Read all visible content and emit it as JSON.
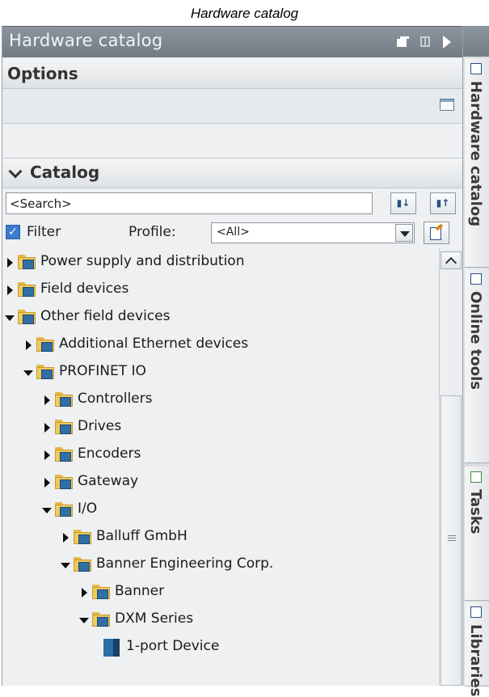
{
  "caption": "Hardware catalog",
  "panel": {
    "title": "Hardware catalog",
    "options_label": "Options",
    "catalog_label": "Catalog"
  },
  "search": {
    "value": "<Search>"
  },
  "filter": {
    "label": "Filter",
    "checked": true,
    "profile_label": "Profile:",
    "profile_value": "<All>"
  },
  "tree": [
    {
      "label": "Power supply and distribution",
      "icon": "folder-icon",
      "state": "collapsed",
      "level": 0
    },
    {
      "label": "Field devices",
      "icon": "folder-icon",
      "state": "collapsed",
      "level": 0
    },
    {
      "label": "Other field devices",
      "icon": "folder-icon",
      "state": "expanded",
      "level": 0
    },
    {
      "label": "Additional Ethernet devices",
      "icon": "folder-icon",
      "state": "collapsed",
      "level": 1
    },
    {
      "label": "PROFINET IO",
      "icon": "folder-icon",
      "state": "expanded",
      "level": 1
    },
    {
      "label": "Controllers",
      "icon": "folder-icon",
      "state": "collapsed",
      "level": 2
    },
    {
      "label": "Drives",
      "icon": "folder-icon",
      "state": "collapsed",
      "level": 2
    },
    {
      "label": "Encoders",
      "icon": "folder-icon",
      "state": "collapsed",
      "level": 2
    },
    {
      "label": "Gateway",
      "icon": "folder-icon",
      "state": "collapsed",
      "level": 2
    },
    {
      "label": "I/O",
      "icon": "folder-icon",
      "state": "expanded",
      "level": 2
    },
    {
      "label": "Balluff GmbH",
      "icon": "folder-icon",
      "state": "collapsed",
      "level": 3
    },
    {
      "label": "Banner Engineering Corp.",
      "icon": "folder-icon",
      "state": "expanded",
      "level": 3
    },
    {
      "label": "Banner",
      "icon": "folder-icon",
      "state": "collapsed",
      "level": 4
    },
    {
      "label": "DXM Series",
      "icon": "folder-icon",
      "state": "expanded",
      "level": 4
    },
    {
      "label": "1-port Device",
      "icon": "device-icon",
      "state": "leaf",
      "level": 5
    }
  ],
  "side_tabs": [
    {
      "label": "Hardware catalog",
      "icon": "catalog-icon"
    },
    {
      "label": "Online tools",
      "icon": "online-tools-icon"
    },
    {
      "label": "Tasks",
      "icon": "tasks-icon"
    },
    {
      "label": "Libraries",
      "icon": "libraries-icon"
    }
  ],
  "colors": {
    "title_bar": "#7f8891",
    "folder": "#f0c95c",
    "device_blue": "#2c6da6",
    "filter_check": "#3b7bcb"
  }
}
